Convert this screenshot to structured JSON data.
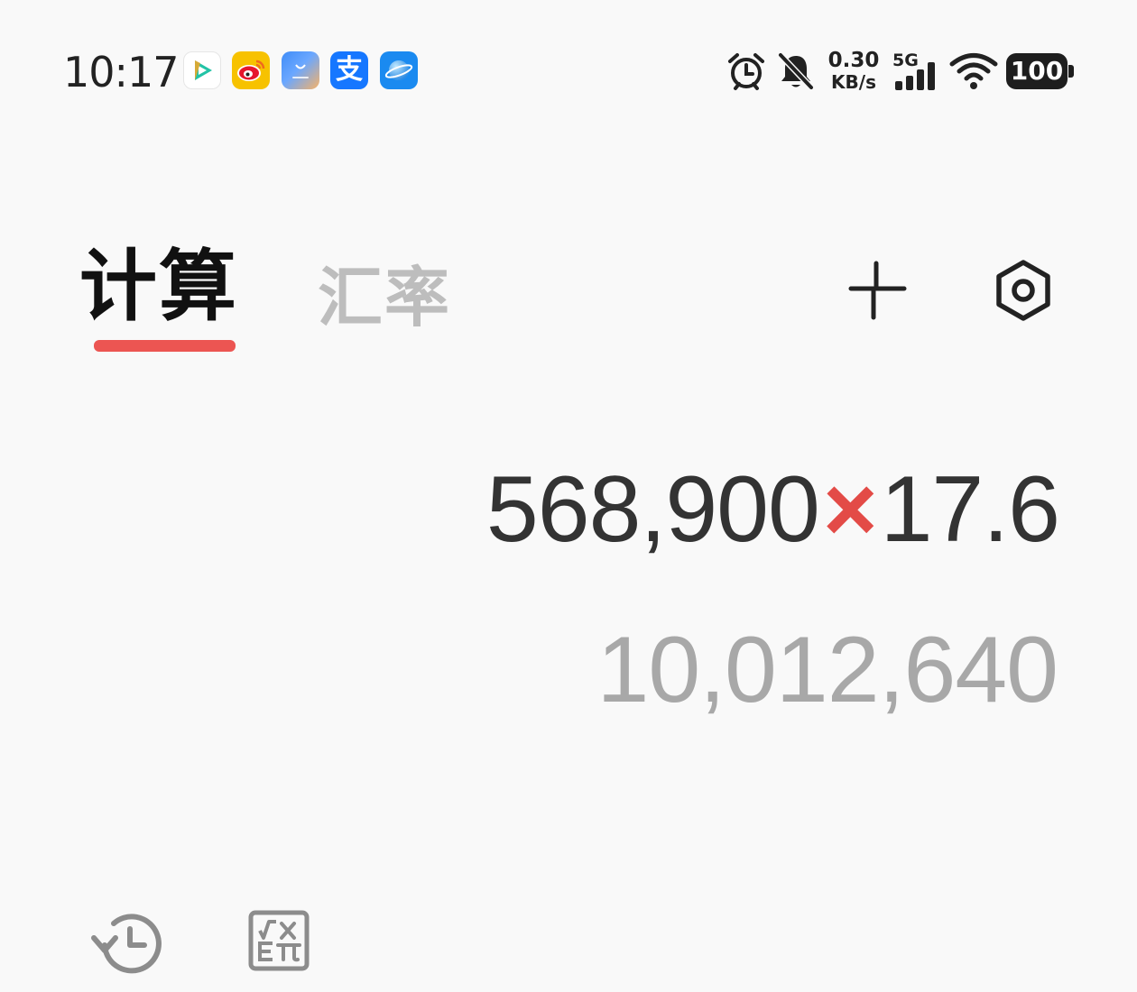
{
  "status_bar": {
    "time": "10:17",
    "apps": [
      {
        "name": "tencent-video-icon",
        "color": "#1fc1a8"
      },
      {
        "name": "weibo-icon",
        "color": "#f5c400"
      },
      {
        "name": "taobao-icon",
        "color": "#4f8df5"
      },
      {
        "name": "alipay-icon",
        "color": "#1677ff"
      },
      {
        "name": "browser-icon",
        "color": "#1d8cf2"
      }
    ],
    "network_speed_value": "0.30",
    "network_speed_unit": "KB/s",
    "signal_label": "5G",
    "battery": "100"
  },
  "tabs": {
    "calculate": "计算",
    "exchange_rate": "汇率",
    "active_color": "#ec5552"
  },
  "actions": {
    "shrink_icon": "shrink-icon",
    "settings_icon": "settings-icon"
  },
  "display": {
    "left_operand": "568,900",
    "operator": "×",
    "right_operand": "17.6",
    "result": "10,012,640",
    "operator_color": "#e34b47"
  },
  "bottom_tools": {
    "history_icon": "history-icon",
    "scientific_icon": "scientific-mode-icon"
  }
}
